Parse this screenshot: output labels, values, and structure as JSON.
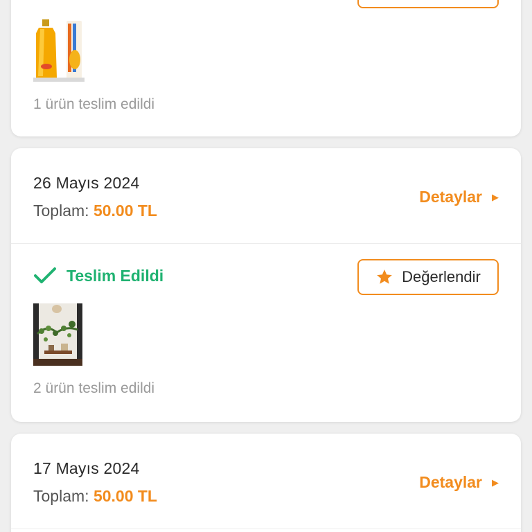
{
  "orders": [
    {
      "delivered_count": "1 ürün teslim edildi"
    },
    {
      "date": "26 Mayıs 2024",
      "total_label": "Toplam:",
      "total_amount": "50.00 TL",
      "details_label": "Detaylar",
      "status": "Teslim Edildi",
      "rate_label": "Değerlendir",
      "delivered_count": "2 ürün teslim edildi"
    },
    {
      "date": "17 Mayıs 2024",
      "total_label": "Toplam:",
      "total_amount": "50.00 TL",
      "details_label": "Detaylar"
    }
  ],
  "icons": {
    "check": "check-icon",
    "star": "star-icon",
    "arrow": "play-arrow-icon"
  },
  "colors": {
    "accent": "#f28c1e",
    "success": "#1fb271",
    "background": "#efefef"
  }
}
